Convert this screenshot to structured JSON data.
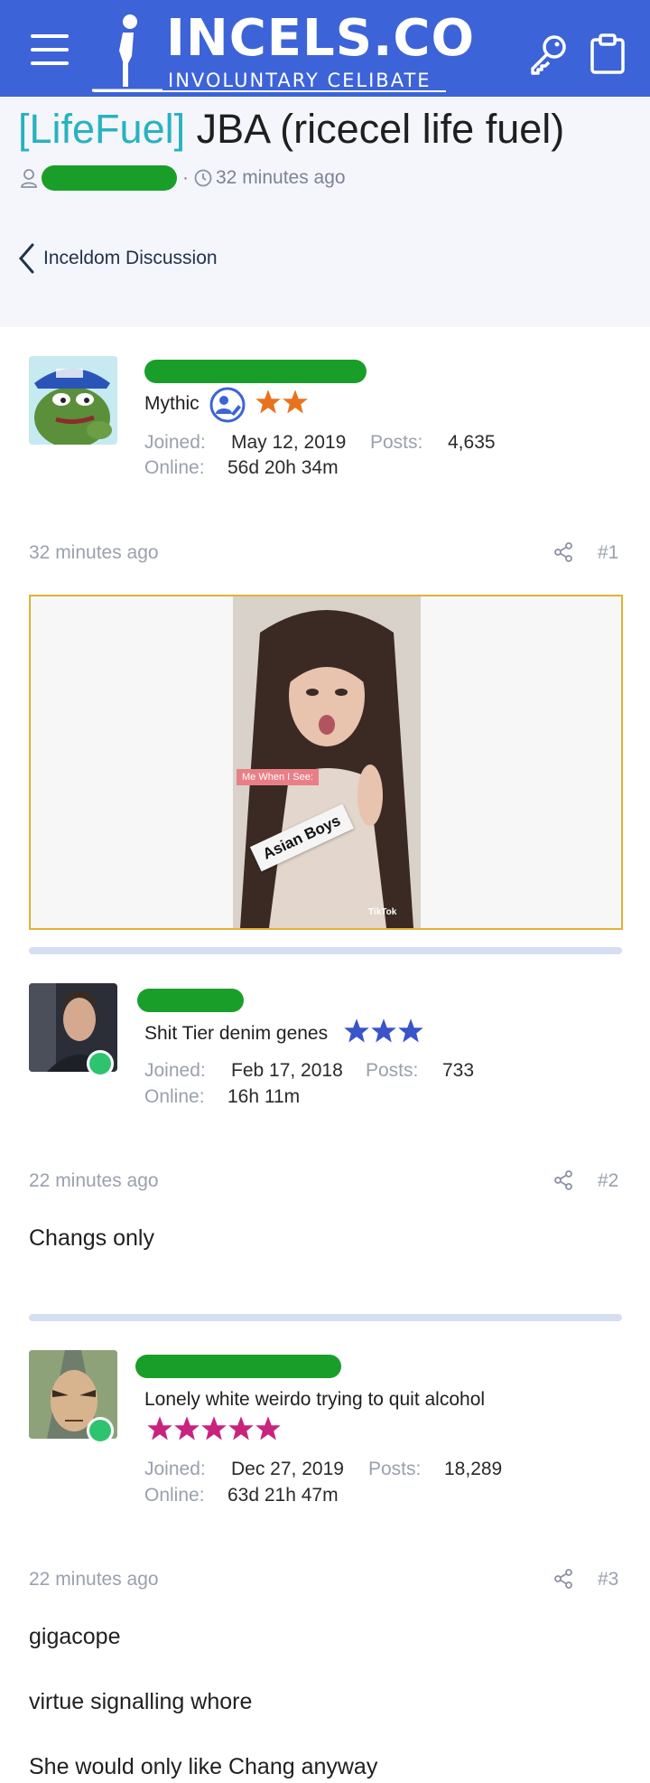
{
  "header": {
    "logo_title": "INCELS.CO",
    "logo_subtitle": "INVOLUNTARY CELIBATE",
    "bg_color": "#3d63d8"
  },
  "thread": {
    "prefix": "[LifeFuel]",
    "title": " JBA (ricecel life fuel)",
    "time": "32 minutes ago",
    "author_icon": "user-icon",
    "clock_icon": "clock-icon"
  },
  "breadcrumb": {
    "label": "Inceldom Discussion"
  },
  "posts": [
    {
      "user_title": "Mythic",
      "stars": 2,
      "star_color": "#e8731e",
      "joined_label": "Joined:",
      "joined": "May 12, 2019",
      "posts_label": "Posts:",
      "posts": "4,635",
      "online_label": "Online:",
      "online": "56d 20h 34m",
      "time": "32 minutes ago",
      "number": "#1",
      "media": {
        "caption_top": "Me When I See:",
        "caption_main": "Asian Boys",
        "watermark": "TikTok"
      }
    },
    {
      "user_title": "Shit Tier denim genes",
      "stars": 3,
      "star_color": "#3a54c9",
      "joined_label": "Joined:",
      "joined": "Feb 17, 2018",
      "posts_label": "Posts:",
      "posts": "733",
      "online_label": "Online:",
      "online": "16h 11m",
      "time": "22 minutes ago",
      "number": "#2",
      "body": [
        "Changs only"
      ]
    },
    {
      "user_title": "Lonely white weirdo trying to quit alcohol",
      "stars": 5,
      "star_color": "#c8237e",
      "joined_label": "Joined:",
      "joined": "Dec 27, 2019",
      "posts_label": "Posts:",
      "posts": "18,289",
      "online_label": "Online:",
      "online": "63d 21h 47m",
      "time": "22 minutes ago",
      "number": "#3",
      "body": [
        "gigacope",
        "virtue signalling whore",
        "She would only like Chang anyway"
      ]
    }
  ]
}
